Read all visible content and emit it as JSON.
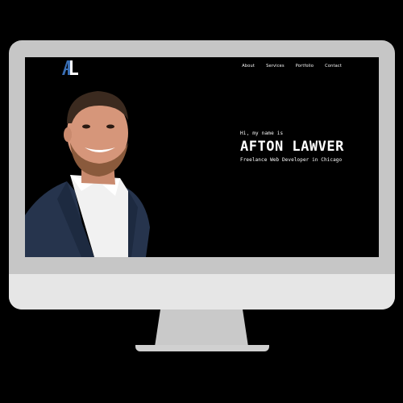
{
  "logo": {
    "icon": "al-logo-icon",
    "colors": {
      "a": "#3a6fb5",
      "l": "#ffffff"
    }
  },
  "nav": {
    "items": [
      {
        "label": "About"
      },
      {
        "label": "Services"
      },
      {
        "label": "Portfolio"
      },
      {
        "label": "Contact"
      }
    ]
  },
  "hero": {
    "greeting": "Hi, my name is",
    "name": "AFTON LAWVER",
    "tagline": "Freelance Web Developer in Chicago"
  },
  "colors": {
    "background": "#000000",
    "monitor_frame": "#c6c6c6",
    "monitor_chin": "#e6e6e6",
    "text": "#ffffff"
  }
}
